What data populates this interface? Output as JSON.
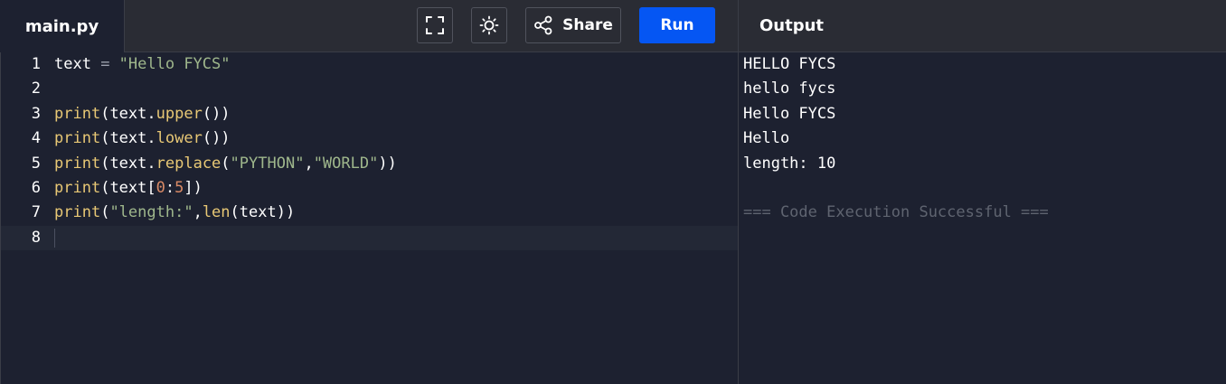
{
  "file_tab": {
    "label": "main.py"
  },
  "toolbar": {
    "fullscreen_icon": "fullscreen-icon",
    "theme_icon": "sun-icon",
    "share_label": "Share",
    "share_icon": "share-icon",
    "run_label": "Run"
  },
  "output_panel": {
    "title": "Output",
    "lines": [
      "HELLO FYCS",
      "hello fycs",
      "Hello FYCS",
      "Hello",
      "length: 10",
      "",
      "=== Code Execution Successful ==="
    ]
  },
  "editor": {
    "active_line": 8,
    "lines": [
      {
        "number": "1",
        "tokens": [
          [
            "text",
            "plain"
          ],
          [
            " = ",
            "op"
          ],
          [
            "\"Hello FYCS\"",
            "str"
          ]
        ]
      },
      {
        "number": "2",
        "tokens": []
      },
      {
        "number": "3",
        "tokens": [
          [
            "print",
            "fn"
          ],
          [
            "(",
            "plain"
          ],
          [
            "text",
            "plain"
          ],
          [
            ".",
            "plain"
          ],
          [
            "upper",
            "fn"
          ],
          [
            "())",
            "plain"
          ]
        ]
      },
      {
        "number": "4",
        "tokens": [
          [
            "print",
            "fn"
          ],
          [
            "(",
            "plain"
          ],
          [
            "text",
            "plain"
          ],
          [
            ".",
            "plain"
          ],
          [
            "lower",
            "fn"
          ],
          [
            "())",
            "plain"
          ]
        ]
      },
      {
        "number": "5",
        "tokens": [
          [
            "print",
            "fn"
          ],
          [
            "(",
            "plain"
          ],
          [
            "text",
            "plain"
          ],
          [
            ".",
            "plain"
          ],
          [
            "replace",
            "fn"
          ],
          [
            "(",
            "plain"
          ],
          [
            "\"PYTHON\"",
            "str"
          ],
          [
            ",",
            "plain"
          ],
          [
            "\"WORLD\"",
            "str"
          ],
          [
            "))",
            "plain"
          ]
        ]
      },
      {
        "number": "6",
        "tokens": [
          [
            "print",
            "fn"
          ],
          [
            "(",
            "plain"
          ],
          [
            "text",
            "plain"
          ],
          [
            "[",
            "plain"
          ],
          [
            "0",
            "num"
          ],
          [
            ":",
            "plain"
          ],
          [
            "5",
            "num"
          ],
          [
            "])",
            "plain"
          ]
        ]
      },
      {
        "number": "7",
        "tokens": [
          [
            "print",
            "fn"
          ],
          [
            "(",
            "plain"
          ],
          [
            "\"length:\"",
            "str"
          ],
          [
            ",",
            "plain"
          ],
          [
            "len",
            "fn"
          ],
          [
            "(",
            "plain"
          ],
          [
            "text",
            "plain"
          ],
          [
            "))",
            "plain"
          ]
        ]
      },
      {
        "number": "8",
        "tokens": []
      }
    ]
  },
  "colors": {
    "background": "#1d2130",
    "topbar": "#2a2c34",
    "run_button": "#0556f3",
    "function": "#e8c875",
    "string": "#9fb78c",
    "number": "#d98a66",
    "status_text": "#5f6470"
  }
}
